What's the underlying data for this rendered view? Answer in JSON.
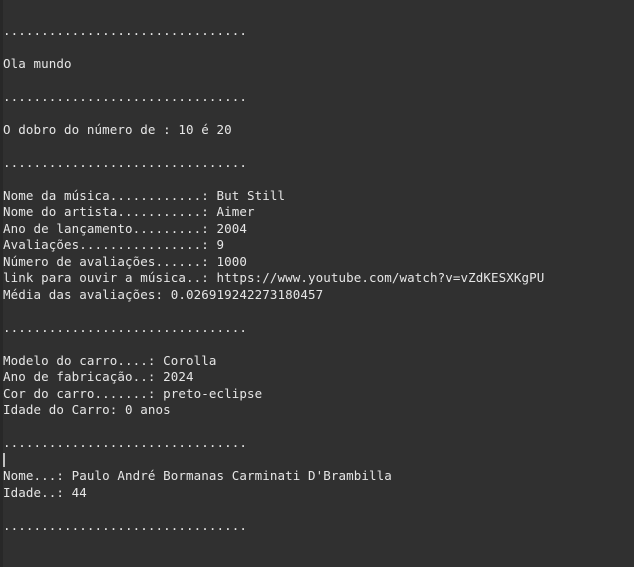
{
  "terminal": {
    "background_color": "#303030",
    "text_color": "#e6e6e6",
    "cursor_color": "#bfbfbf",
    "separator": "................................",
    "lines": {
      "blank": " ",
      "hello": "Ola mundo",
      "double": "O dobro do número de : 10 é 20",
      "music_name": "Nome da música............: But Still",
      "music_artist": "Nome do artista...........: Aimer",
      "music_year": "Ano de lançamento.........: 2004",
      "music_ratings": "Avaliações................: 9",
      "music_num_ratings": "Número de avaliações......: 1000",
      "music_link": "link para ouvir a música..: https://www.youtube.com/watch?v=vZdKESXKgPU",
      "music_average": "Média das avaliações: 0.026919242273180457",
      "car_model": "Modelo do carro....: Corolla",
      "car_year": "Ano de fabricação..: 2024",
      "car_color": "Cor do carro.......: preto-eclipse",
      "car_age": "Idade do Carro: 0 anos",
      "person_name": "Nome...: Paulo André Bormanas Carminati D'Brambilla",
      "person_age": "Idade..: 44"
    }
  }
}
